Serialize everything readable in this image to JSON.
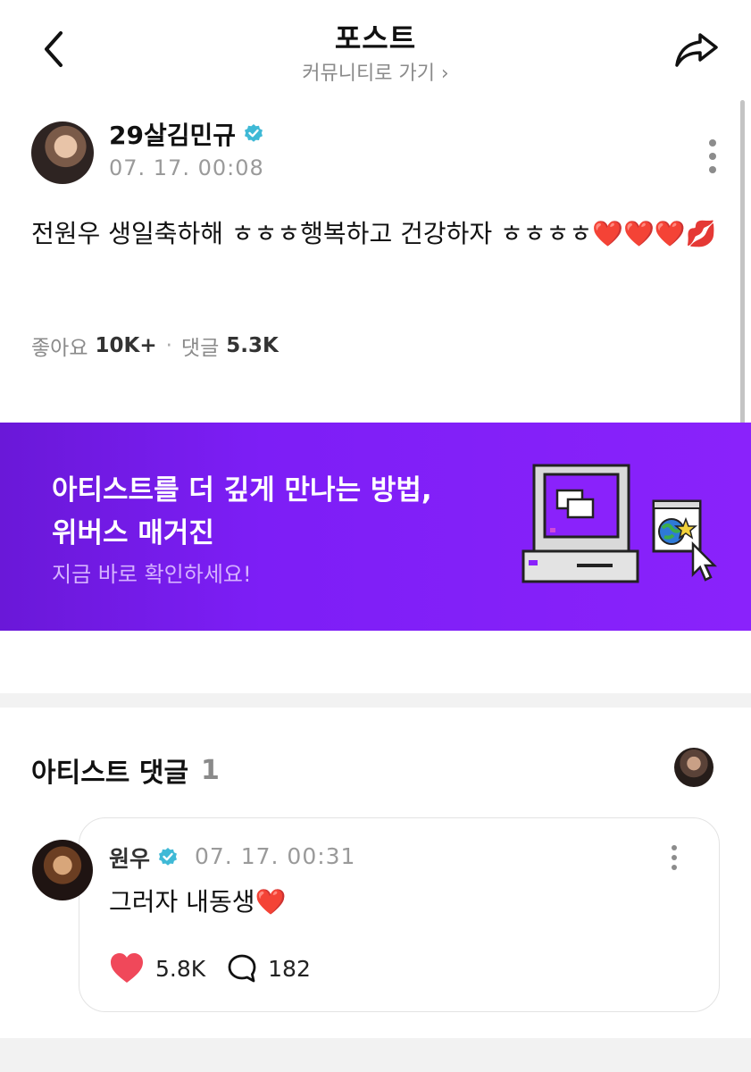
{
  "header": {
    "title": "포스트",
    "community_link": "커뮤니티로 가기 ›"
  },
  "post": {
    "author_name": "29살김민규",
    "time": "07. 17. 00:08",
    "body": "전원우 생일축하해 ㅎㅎㅎ행복하고 건강하자 ㅎㅎㅎㅎ❤️❤️❤️💋",
    "likes_label": "좋아요",
    "likes_count": "10K+",
    "comments_label": "댓글",
    "comments_count": "5.3K"
  },
  "banner": {
    "line1": "아티스트를 더 깊게 만나는 방법,",
    "line2": "위버스 매거진",
    "subtitle": "지금 바로 확인하세요!",
    "background": "#7d1ef6"
  },
  "artist_comments": {
    "title": "아티스트 댓글",
    "count": "1",
    "items": [
      {
        "author": "원우",
        "time": "07. 17. 00:31",
        "text": "그러자 내동생❤️",
        "likes": "5.8K",
        "replies": "182"
      }
    ]
  },
  "colors": {
    "verified": "#3fb9d6",
    "heart": "#f0485a",
    "muted": "#8a8a8a"
  },
  "icons": {
    "back": "chevron-left-icon",
    "share": "share-icon",
    "more": "more-vertical-icon",
    "verified": "verified-badge-icon",
    "like": "heart-icon",
    "reply": "comment-bubble-icon"
  }
}
